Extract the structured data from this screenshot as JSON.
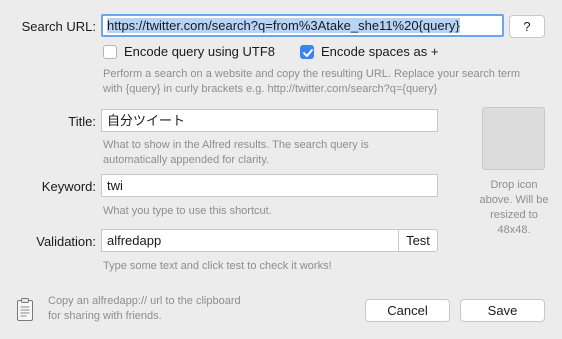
{
  "search_url": {
    "label": "Search URL:",
    "value": "https://twitter.com/search?q=from%3Atake_she11%20{query}",
    "help_button": "?"
  },
  "options": {
    "encode_utf8": {
      "label": "Encode query using UTF8",
      "checked": false
    },
    "encode_spaces": {
      "label": "Encode spaces as +",
      "checked": true
    }
  },
  "search_hint": "Perform a search on a website and copy the resulting URL. Replace your search term with {query} in curly brackets e.g. http://twitter.com/search?q={query}",
  "title": {
    "label": "Title:",
    "value": "自分ツイート",
    "hint": "What to show in the Alfred results. The search query is automatically appended for clarity."
  },
  "keyword": {
    "label": "Keyword:",
    "value": "twi",
    "hint": "What you type to use this shortcut."
  },
  "validation": {
    "label": "Validation:",
    "value": "alfredapp",
    "test_button": "Test",
    "hint": "Type some text and click test to check it works!"
  },
  "icon_drop": {
    "hint": "Drop icon above. Will be resized to 48x48."
  },
  "footer": {
    "copy_hint": "Copy an alfredapp:// url to the clipboard for sharing with friends.",
    "cancel_label": "Cancel",
    "save_label": "Save",
    "accent_color": "#3b82f6"
  }
}
